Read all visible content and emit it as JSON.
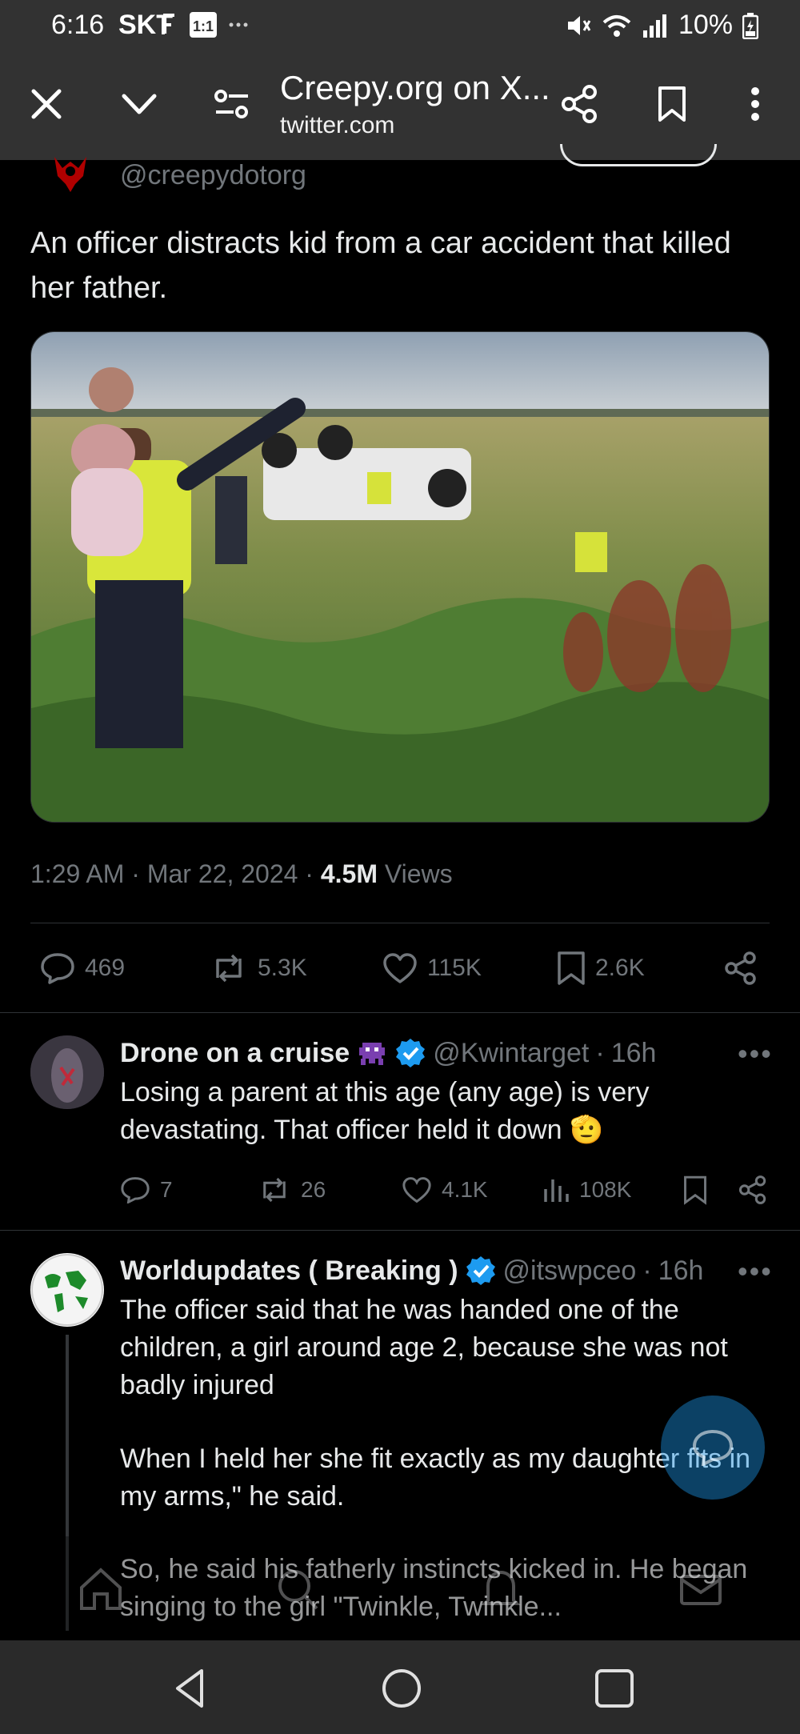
{
  "status_bar": {
    "time": "6:16",
    "carrier": "SKT",
    "battery": "10%"
  },
  "browser": {
    "title": "Creepy.org on X...",
    "domain": "twitter.com"
  },
  "tweet": {
    "handle": "@creepydotorg",
    "text": "An officer distracts kid from a car accident that killed her father.",
    "time": "1:29 AM",
    "date": "Mar 22, 2024",
    "views_count": "4.5M",
    "views_label": "Views",
    "replies": "469",
    "reposts": "5.3K",
    "likes": "115K",
    "bookmarks": "2.6K"
  },
  "replies": [
    {
      "name": "Drone on a cruise",
      "handle": "@Kwintarget",
      "age": "16h",
      "text": "Losing a parent at this age (any age) is very devastating. That officer held it down 🫡",
      "replies": "7",
      "reposts": "26",
      "likes": "4.1K",
      "views": "108K"
    },
    {
      "name": "Worldupdates ( Breaking )",
      "handle": "@itswpceo",
      "age": "16h",
      "text_p1": "The officer said that he was handed one of the children, a girl around age 2, because she was not badly injured",
      "text_p2": "When I held her she fit exactly as my daughter fits in my arms,\" he said.",
      "text_p3": "So, he said his fatherly instincts kicked in. He began singing to the girl \"Twinkle, Twinkle..."
    }
  ],
  "colors": {
    "background": "#000000",
    "chrome": "#323232",
    "muted": "#71767b",
    "text": "#e7e9ea",
    "verified": "#1d9bf0"
  }
}
